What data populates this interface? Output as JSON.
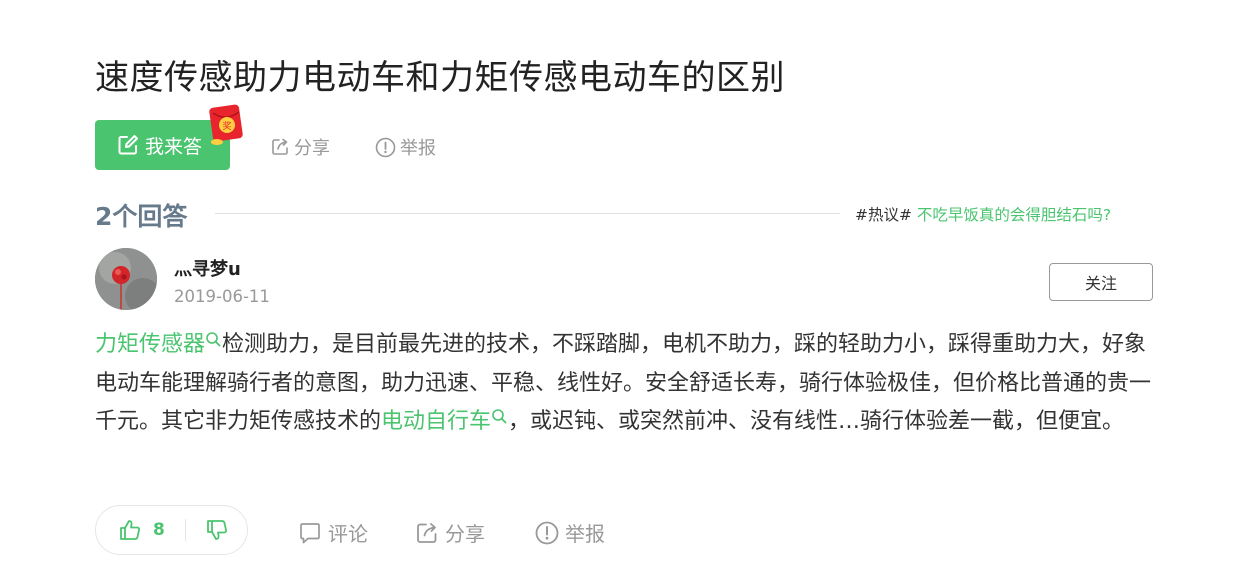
{
  "question": {
    "title": "速度传感助力电动车和力矩传感电动车的区别",
    "answer_button_label": "我来答",
    "share_label": "分享",
    "report_label": "举报",
    "redpack_char": "奖"
  },
  "answers_header": {
    "count_label": "2个回答",
    "hot_tag": "#热议#",
    "hot_link": "不吃早饭真的会得胆结石吗?"
  },
  "answer": {
    "user_name": "灬寻梦u",
    "date": "2019-06-11",
    "follow_label": "关注",
    "keyword_1": "力矩传感器",
    "text_1": "检测助力，是目前最先进的技术，不踩踏脚，电机不助力，踩的轻助力小，踩得重助力大，好象电动车能理解骑行者的意图，助力迅速、平稳、线性好。安全舒适长寿，骑行体验极佳，但价格比普通的贵一千元。其它非力矩传感技术的",
    "keyword_2": "电动自行车",
    "text_2": "，或迟钝、或突然前冲、没有线性…骑行体验差一截，但便宜。",
    "like_count": "8",
    "comment_label": "评论",
    "share_label": "分享",
    "report_label": "举报"
  },
  "colors": {
    "accent_green": "#4bc46f",
    "muted_gray": "#999999",
    "header_gray": "#667a8c"
  }
}
